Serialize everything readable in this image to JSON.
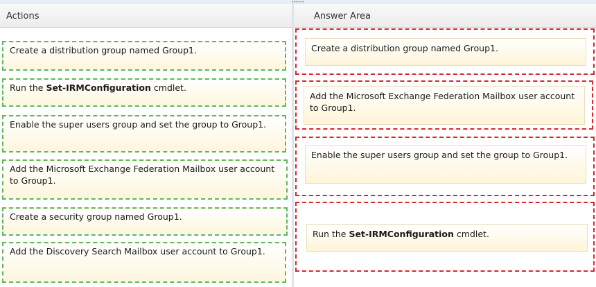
{
  "headers": {
    "actions": "Actions",
    "answer_area": "Answer Area"
  },
  "actions": [
    {
      "segments": [
        {
          "text": "Create a distribution group named Group1.",
          "bold": false
        }
      ]
    },
    {
      "segments": [
        {
          "text": "Run the ",
          "bold": false
        },
        {
          "text": "Set-IRMConfiguration",
          "bold": true
        },
        {
          "text": " cmdlet.",
          "bold": false
        }
      ]
    },
    {
      "segments": [
        {
          "text": "Enable the super users group and set the group to Group1.",
          "bold": false
        }
      ]
    },
    {
      "segments": [
        {
          "text": "Add the Microsoft Exchange Federation Mailbox user account to Group1.",
          "bold": false
        }
      ]
    },
    {
      "segments": [
        {
          "text": "Create a security group named Group1.",
          "bold": false
        }
      ]
    },
    {
      "segments": [
        {
          "text": "Add the Discovery Search Mailbox user account to Group1.",
          "bold": false
        }
      ]
    }
  ],
  "answers": [
    {
      "segments": [
        {
          "text": "Create a distribution group named Group1.",
          "bold": false
        }
      ]
    },
    {
      "segments": [
        {
          "text": "Add the Microsoft Exchange Federation Mailbox user account to Group1.",
          "bold": false
        }
      ]
    },
    {
      "segments": [
        {
          "text": "Enable the super users group and set the group to Group1.",
          "bold": false
        }
      ]
    },
    {
      "segments": [
        {
          "text": "Run the ",
          "bold": false
        },
        {
          "text": "Set-IRMConfiguration",
          "bold": true
        },
        {
          "text": " cmdlet.",
          "bold": false
        }
      ]
    }
  ],
  "colors": {
    "action_border": "#5cb85c",
    "answer_border": "#d9262a",
    "card_bg": "#fdf6dd"
  }
}
